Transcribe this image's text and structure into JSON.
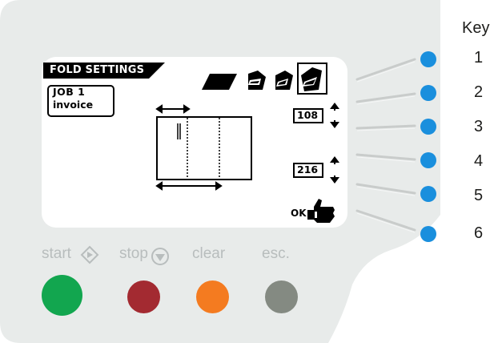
{
  "screen": {
    "title": "FOLD SETTINGS",
    "job_label": "JOB  1",
    "job_name": "invoice",
    "value_1": "108",
    "value_2": "216",
    "ok_label": "OK"
  },
  "buttons": [
    {
      "label": "start",
      "color": "#12a64f"
    },
    {
      "label": "stop",
      "color": "#a32a31"
    },
    {
      "label": "clear",
      "color": "#f47b20"
    },
    {
      "label": "esc.",
      "color": "#848a82"
    }
  ],
  "key": {
    "title": "Key",
    "items": [
      "1",
      "2",
      "3",
      "4",
      "5",
      "6"
    ]
  },
  "colors": {
    "panel": "#e8ebea",
    "side_button": "#1a8fdd",
    "label_gray": "#b8bdbd"
  }
}
